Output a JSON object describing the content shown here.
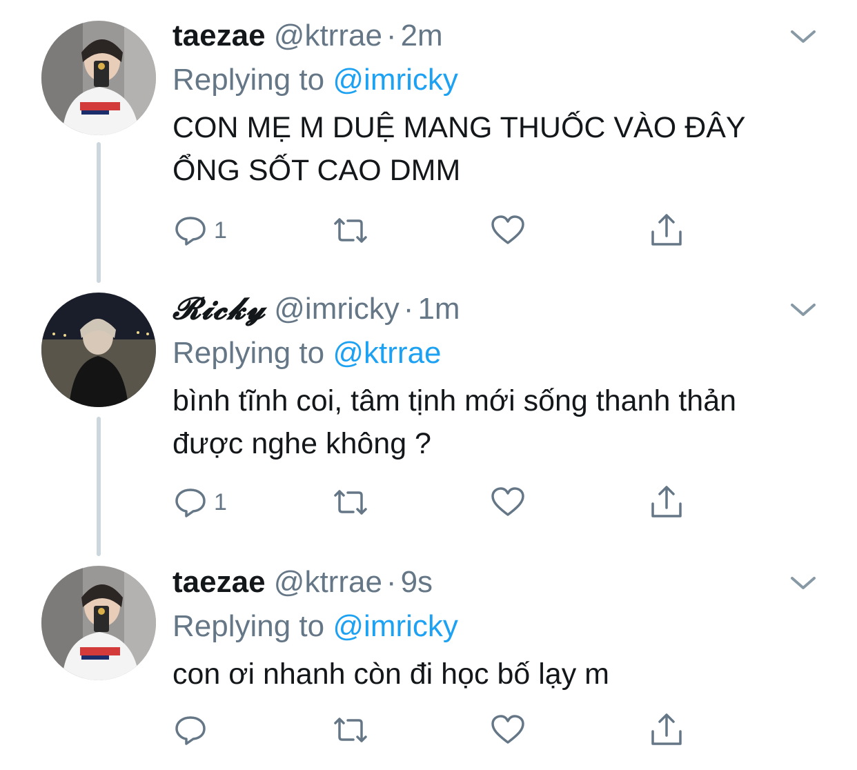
{
  "colors": {
    "link": "#1da1f2",
    "muted": "#657786",
    "text": "#14171a",
    "thread_line": "#ccd6dd"
  },
  "tweets": [
    {
      "name": "taezae",
      "handle": "@ktrrae",
      "dot": "·",
      "time": "2m",
      "replying_prefix": "Replying to",
      "replying_to": "@imricky",
      "text_lines": [
        "CON MẸ M DUỆ MANG THUỐC VÀO ĐÂY",
        "ỔNG SỐT CAO DMM"
      ],
      "reply_count": "1",
      "icons": [
        "reply-icon",
        "retweet-icon",
        "like-icon",
        "share-icon",
        "chevron-down-icon"
      ]
    },
    {
      "name": "𝓡𝓲𝓬𝓴𝔂",
      "handle": "@imricky",
      "dot": "·",
      "time": "1m",
      "replying_prefix": "Replying to",
      "replying_to": "@ktrrae",
      "text_lines": [
        "bình tĩnh coi, tâm tịnh mới sống thanh thản",
        "được nghe không ?"
      ],
      "reply_count": "1",
      "icons": [
        "reply-icon",
        "retweet-icon",
        "like-icon",
        "share-icon",
        "chevron-down-icon"
      ]
    },
    {
      "name": "taezae",
      "handle": "@ktrrae",
      "dot": "·",
      "time": "9s",
      "replying_prefix": "Replying to",
      "replying_to": "@imricky",
      "text_lines": [
        "con ơi nhanh còn đi học bố lạy m"
      ],
      "reply_count": "",
      "icons": [
        "reply-icon",
        "retweet-icon",
        "like-icon",
        "share-icon",
        "chevron-down-icon"
      ]
    }
  ]
}
